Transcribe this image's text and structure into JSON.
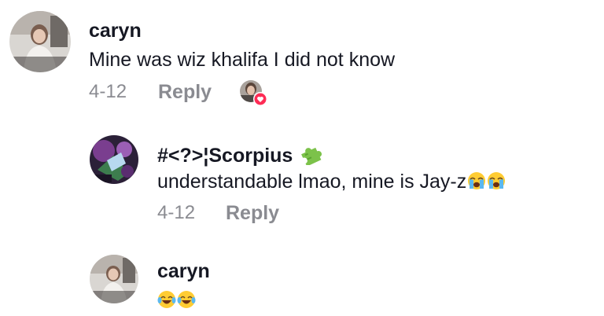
{
  "comments": [
    {
      "username": "caryn",
      "text": "Mine was wiz khalifa I did not know",
      "date": "4-12",
      "reply_label": "Reply"
    },
    {
      "username": "#<?>¦Scorpius",
      "text": "understandable lmao, mine is Jay-z",
      "date": "4-12",
      "reply_label": "Reply",
      "emojis": [
        "loudly-crying-face",
        "loudly-crying-face"
      ],
      "username_badge": "puzzle-piece-emoji"
    },
    {
      "username": "caryn",
      "text": "",
      "emojis": [
        "tears-of-joy-face",
        "tears-of-joy-face"
      ]
    }
  ],
  "colors": {
    "username": "#161823",
    "meta": "#8a8b91",
    "heart_badge": "#fe2c55",
    "puzzle": "#7cc24a"
  }
}
